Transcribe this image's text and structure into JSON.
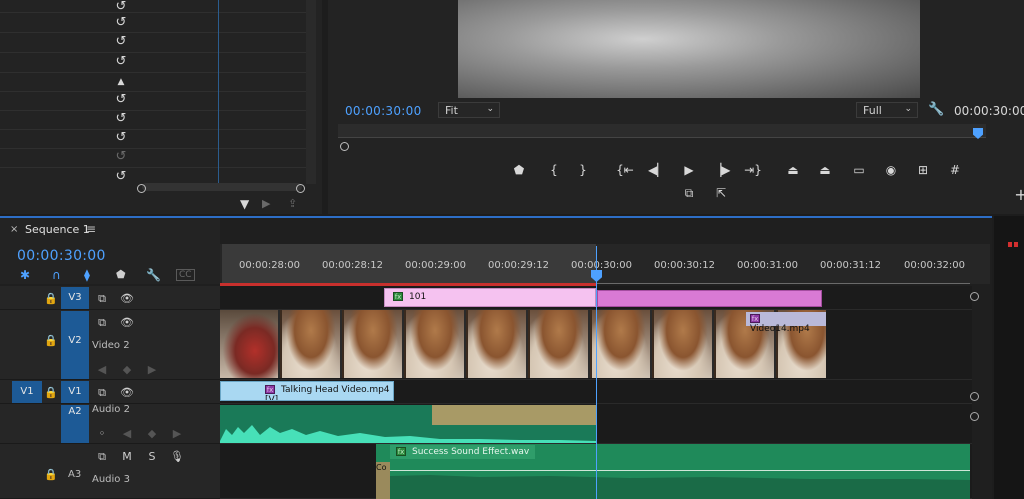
{
  "monitor": {
    "timecode_left": "00:00:30:00",
    "fit_label": "Fit",
    "full_label": "Full",
    "timecode_right": "00:00:30:00"
  },
  "timeline": {
    "sequence_name": "Sequence 1",
    "timecode": "00:00:30:00",
    "ruler": [
      "00:00:28:00",
      "00:00:28:12",
      "00:00:29:00",
      "00:00:29:12",
      "00:00:30:00",
      "00:00:30:12",
      "00:00:31:00",
      "00:00:31:12",
      "00:00:32:00"
    ],
    "tracks": {
      "v3": {
        "label": "V3"
      },
      "v2": {
        "label": "V2",
        "name": "Video 2"
      },
      "v1": {
        "label": "V1",
        "source": "V1"
      },
      "a2": {
        "label": "A2",
        "name": "Audio 2"
      },
      "a3": {
        "label": "A3",
        "name": "Audio 3",
        "m": "M",
        "s": "S"
      }
    },
    "clips": {
      "adjust": "101",
      "video14": "Video14.mp4",
      "talking_head": "Talking Head Video.mp4 [V]",
      "success": "Success Sound Effect.wav",
      "a3_label": "Co"
    }
  },
  "colors": {
    "accent": "#4ea1ff",
    "target": "#1d5a96",
    "pink_clip": "#f2b6ec",
    "blue_clip": "#a9d8f2",
    "audio_green": "#1f8a5a"
  }
}
